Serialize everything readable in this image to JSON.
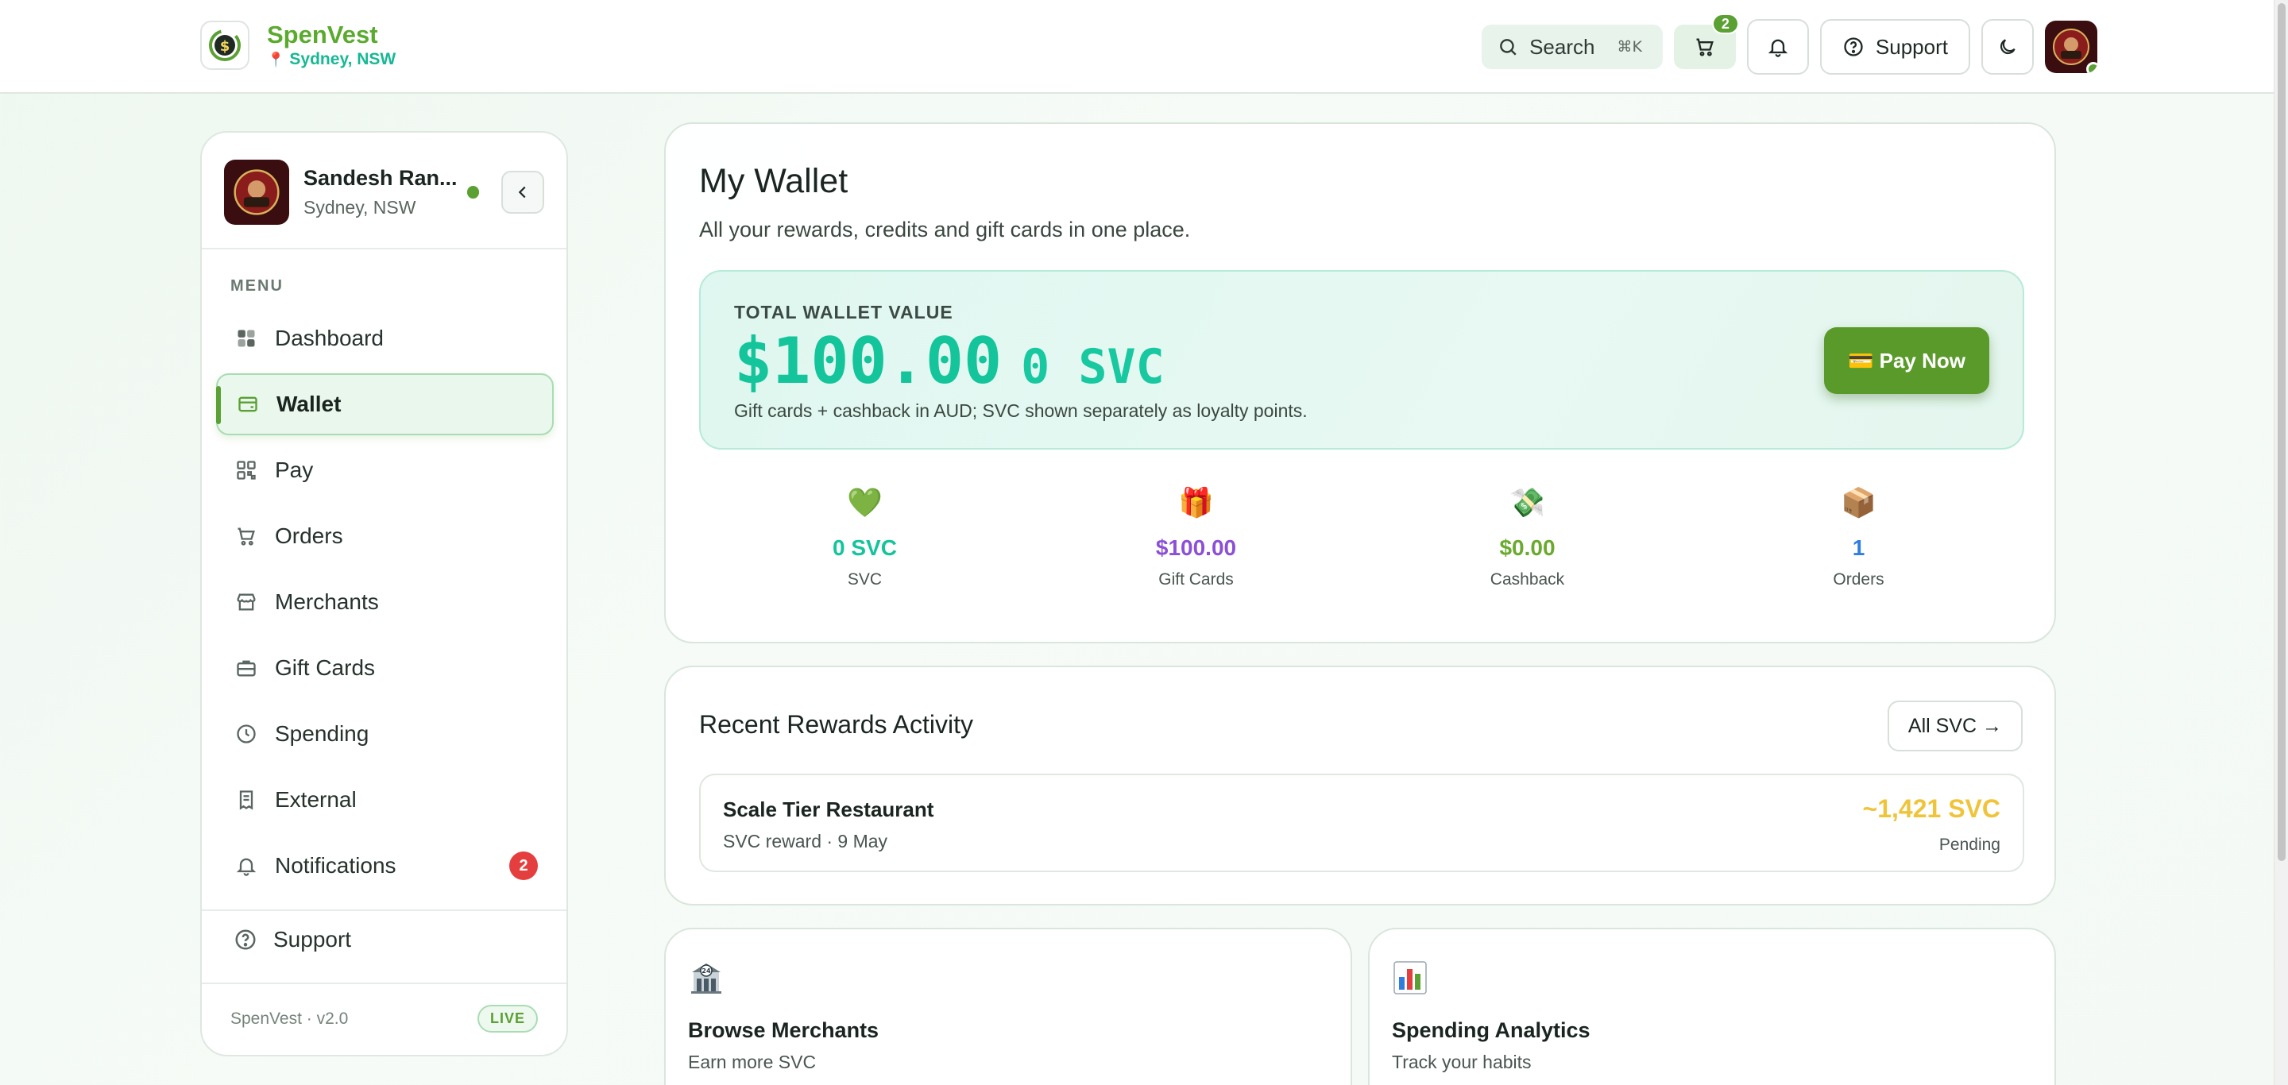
{
  "brand": {
    "name": "SpenVest",
    "location": "Sydney, NSW"
  },
  "header": {
    "search_label": "Search",
    "search_shortcut": "⌘K",
    "cart_count": "2",
    "support_label": "Support"
  },
  "sidebar": {
    "profile_name": "Sandesh Ran...",
    "profile_location": "Sydney, NSW",
    "menu_label": "MENU",
    "items": [
      {
        "label": "Dashboard",
        "icon": "grid-icon"
      },
      {
        "label": "Wallet",
        "icon": "wallet-icon"
      },
      {
        "label": "Pay",
        "icon": "qr-icon"
      },
      {
        "label": "Orders",
        "icon": "cart-icon"
      },
      {
        "label": "Merchants",
        "icon": "store-icon"
      },
      {
        "label": "Gift Cards",
        "icon": "briefcase-icon"
      },
      {
        "label": "Spending",
        "icon": "clock-icon"
      },
      {
        "label": "External",
        "icon": "receipt-icon"
      },
      {
        "label": "Notifications",
        "icon": "bell-icon",
        "badge": "2"
      }
    ],
    "support_label": "Support",
    "version": "SpenVest · v2.0",
    "live_label": "LIVE"
  },
  "wallet": {
    "title": "My Wallet",
    "subtitle": "All your rewards, credits and gift cards in one place.",
    "total_label": "TOTAL WALLET VALUE",
    "total_amount": "$100.00",
    "total_svc": "0 SVC",
    "total_note": "Gift cards + cashback in AUD; SVC shown separately as loyalty points.",
    "pay_button": "💳 Pay Now",
    "stats": [
      {
        "emoji": "💚",
        "value": "0 SVC",
        "label": "SVC",
        "color": "#14c49a"
      },
      {
        "emoji": "🎁",
        "value": "$100.00",
        "label": "Gift Cards",
        "color": "#8b4fd8"
      },
      {
        "emoji": "💸",
        "value": "$0.00",
        "label": "Cashback",
        "color": "#6aaa2e"
      },
      {
        "emoji": "📦",
        "value": "1",
        "label": "Orders",
        "color": "#2f7de1"
      }
    ]
  },
  "activity": {
    "title": "Recent Rewards Activity",
    "all_button": "All SVC →",
    "rows": [
      {
        "name": "Scale Tier Restaurant",
        "meta": "SVC reward · 9 May",
        "amount": "~1,421 SVC",
        "status": "Pending"
      }
    ]
  },
  "shortcuts": [
    {
      "title": "Browse Merchants",
      "subtitle": "Earn more SVC",
      "icon": "atm-building-icon"
    },
    {
      "title": "Spending Analytics",
      "subtitle": "Track your habits",
      "icon": "bar-chart-icon"
    }
  ],
  "colors": {
    "brand_green": "#5aa032",
    "accent_teal": "#14c49a",
    "danger": "#e53e3e",
    "pending": "#f0c43a"
  }
}
